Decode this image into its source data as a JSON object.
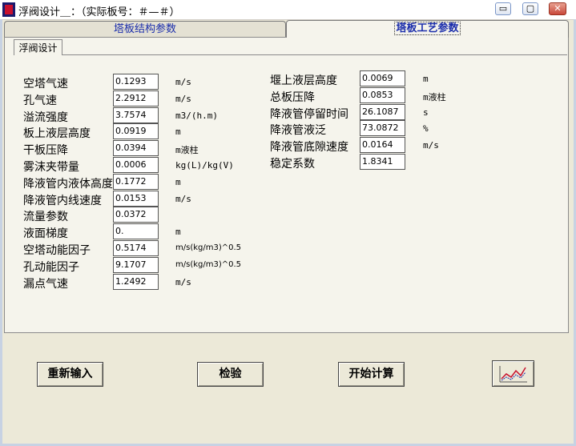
{
  "window": {
    "title": "浮阀设计＿：（实际板号：＃—＃）",
    "buttons": {
      "minimize": "▭",
      "restore": "▢",
      "close": "✕"
    }
  },
  "tabs": [
    {
      "label": "塔板结构参数",
      "active": false
    },
    {
      "label": "塔板工艺参数",
      "active": true
    }
  ],
  "subtab": {
    "label": "浮阀设计"
  },
  "left_params": [
    {
      "label": "空塔气速",
      "value": "0.1293",
      "unit": "m/s"
    },
    {
      "label": "孔气速",
      "value": "2.2912",
      "unit": "m/s"
    },
    {
      "label": "溢流强度",
      "value": "3.7574",
      "unit": "m3/(h.m)"
    },
    {
      "label": "板上液层高度",
      "value": "0.0919",
      "unit": "m"
    },
    {
      "label": "干板压降",
      "value": "0.0394",
      "unit": "m液柱"
    },
    {
      "label": "雾沫夹带量",
      "value": "0.0006",
      "unit": "kg(L)/kg(V)"
    },
    {
      "label": "降液管内液体高度",
      "value": "0.1772",
      "unit": "m"
    },
    {
      "label": "降液管内线速度",
      "value": "0.0153",
      "unit": "m/s"
    },
    {
      "label": "流量参数",
      "value": "0.0372",
      "unit": ""
    },
    {
      "label": "液面梯度",
      "value": "0.",
      "unit": "m"
    },
    {
      "label": "空塔动能因子",
      "value": "0.5174",
      "unit": "m/s(kg/m3)^0.5"
    },
    {
      "label": "孔动能因子",
      "value": "9.1707",
      "unit": "m/s(kg/m3)^0.5"
    },
    {
      "label": "漏点气速",
      "value": "1.2492",
      "unit": "m/s"
    }
  ],
  "right_params": [
    {
      "label": "堰上液层高度",
      "value": "0.0069",
      "unit": "m"
    },
    {
      "label": "总板压降",
      "value": "0.0853",
      "unit": "m液柱"
    },
    {
      "label": "降液管停留时间",
      "value": "26.1087",
      "unit": "s"
    },
    {
      "label": "降液管液泛",
      "value": "73.0872",
      "unit": "%"
    },
    {
      "label": "降液管底隙速度",
      "value": "0.0164",
      "unit": "m/s"
    },
    {
      "label": "稳定系数",
      "value": "1.8341",
      "unit": ""
    }
  ],
  "actions": {
    "reset": "重新输入",
    "check": "检验",
    "calculate": "开始计算",
    "chart_icon": "line-chart-icon"
  },
  "colors": {
    "tab_text": "#1a2dab",
    "face": "#ece9d8"
  }
}
